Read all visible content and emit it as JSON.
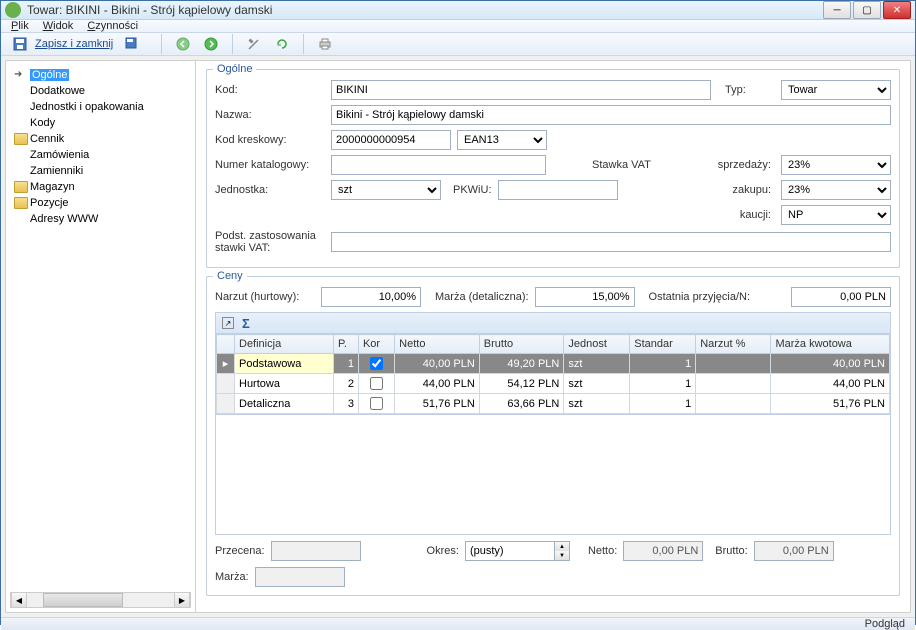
{
  "window": {
    "title": "Towar: BIKINI - Bikini - Strój kąpielowy damski"
  },
  "menu": {
    "file": "Plik",
    "view": "Widok",
    "actions": "Czynności"
  },
  "toolbar": {
    "save_close": "Zapisz i zamknij"
  },
  "sidebar": {
    "items": [
      {
        "label": "Ogólne",
        "kind": "arrow",
        "selected": true
      },
      {
        "label": "Dodatkowe",
        "kind": "plain"
      },
      {
        "label": "Jednostki i opakowania",
        "kind": "plain"
      },
      {
        "label": "Kody",
        "kind": "plain"
      },
      {
        "label": "Cennik",
        "kind": "folder"
      },
      {
        "label": "Zamówienia",
        "kind": "plain"
      },
      {
        "label": "Zamienniki",
        "kind": "plain"
      },
      {
        "label": "Magazyn",
        "kind": "folder"
      },
      {
        "label": "Pozycje",
        "kind": "folder"
      },
      {
        "label": "Adresy WWW",
        "kind": "plain"
      }
    ]
  },
  "general": {
    "group_title": "Ogólne",
    "labels": {
      "kod": "Kod:",
      "typ": "Typ:",
      "nazwa": "Nazwa:",
      "kod_kreskowy": "Kod kreskowy:",
      "numer_katalogowy": "Numer katalogowy:",
      "stawka_vat": "Stawka VAT",
      "jednostka": "Jednostka:",
      "pkwiu": "PKWiU:",
      "sprzedazy": "sprzedaży:",
      "zakupu": "zakupu:",
      "kaucji": "kaucji:",
      "podst": "Podst. zastosowania stawki VAT:"
    },
    "values": {
      "kod": "BIKINI",
      "typ": "Towar",
      "nazwa": "Bikini - Strój kąpielowy damski",
      "kod_kreskowy": "2000000000954",
      "kod_typ": "EAN13",
      "numer_katalogowy": "",
      "jednostka": "szt",
      "pkwiu": "",
      "vat_sprzedazy": "23%",
      "vat_zakupu": "23%",
      "vat_kaucji": "NP",
      "podst": ""
    }
  },
  "ceny": {
    "group_title": "Ceny",
    "labels": {
      "narzut": "Narzut (hurtowy):",
      "marza_det": "Marża (detaliczna):",
      "ostatnia": "Ostatnia przyjęcia/N:"
    },
    "values": {
      "narzut": "10,00%",
      "marza_det": "15,00%",
      "ostatnia": "0,00 PLN"
    },
    "columns": [
      "Definicja",
      "P.",
      "Kor",
      "Netto",
      "Brutto",
      "Jednost",
      "Standar",
      "Narzut %",
      "Marża kwotowa"
    ],
    "rows": [
      {
        "def": "Podstawowa",
        "p": "1",
        "kor": true,
        "netto": "40,00 PLN",
        "brutto": "49,20 PLN",
        "jedn": "szt",
        "std": "1",
        "narzut": "",
        "marza": "40,00 PLN",
        "selected": true
      },
      {
        "def": "Hurtowa",
        "p": "2",
        "kor": false,
        "netto": "44,00 PLN",
        "brutto": "54,12 PLN",
        "jedn": "szt",
        "std": "1",
        "narzut": "",
        "marza": "44,00 PLN"
      },
      {
        "def": "Detaliczna",
        "p": "3",
        "kor": false,
        "netto": "51,76 PLN",
        "brutto": "63,66 PLN",
        "jedn": "szt",
        "std": "1",
        "narzut": "",
        "marza": "51,76 PLN"
      }
    ],
    "bottom": {
      "przecena": "Przecena:",
      "przecena_v": "",
      "okres": "Okres:",
      "okres_v": "(pusty)",
      "netto": "Netto:",
      "netto_v": "0,00 PLN",
      "brutto": "Brutto:",
      "brutto_v": "0,00 PLN",
      "marza": "Marża:",
      "marza_v": ""
    }
  },
  "status": {
    "text": "Podgląd"
  }
}
